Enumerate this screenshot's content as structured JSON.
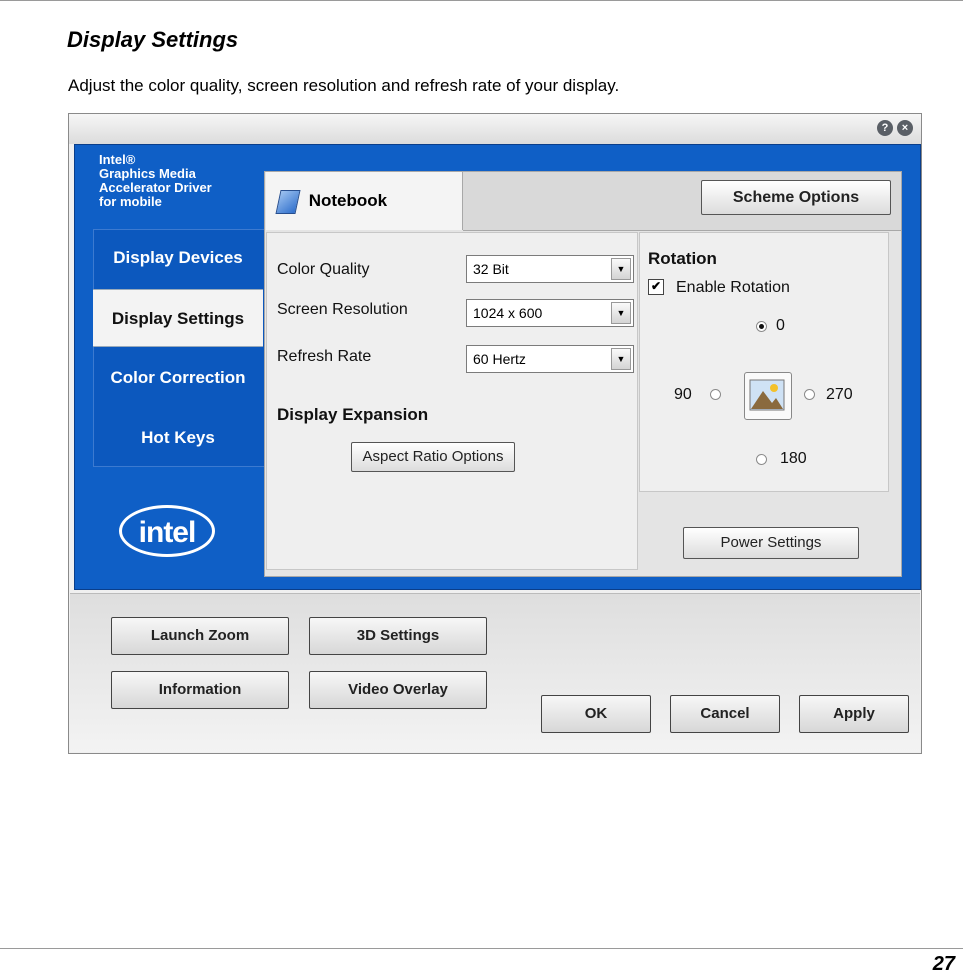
{
  "doc": {
    "title": "Display Settings",
    "description": "Adjust the color quality, screen resolution and refresh rate of your display.",
    "page_number": "27"
  },
  "window": {
    "titlebar_buttons": [
      {
        "icon": "help-icon",
        "glyph": "?"
      },
      {
        "icon": "close-icon",
        "glyph": "×"
      }
    ]
  },
  "sidebar": {
    "brand_lines": [
      "Intel®",
      "Graphics Media",
      "Accelerator Driver",
      "for mobile"
    ],
    "items": [
      {
        "label": "Display Devices",
        "active": false
      },
      {
        "label": "Display Settings",
        "active": true
      },
      {
        "label": "Color Correction",
        "active": false
      },
      {
        "label": "Hot Keys",
        "active": false
      }
    ],
    "logo_text": "intel"
  },
  "tab": {
    "label": "Notebook",
    "icon": "notebook-icon"
  },
  "scheme_options_label": "Scheme Options",
  "settings": {
    "color_quality_label": "Color Quality",
    "color_quality_value": "32 Bit",
    "screen_resolution_label": "Screen Resolution",
    "screen_resolution_value": "1024 x 600",
    "refresh_rate_label": "Refresh Rate",
    "refresh_rate_value": "60 Hertz",
    "display_expansion_heading": "Display Expansion",
    "aspect_ratio_button": "Aspect Ratio Options"
  },
  "rotation": {
    "heading": "Rotation",
    "enable_label": "Enable Rotation",
    "enabled": true,
    "options": {
      "r0": "0",
      "r90": "90",
      "r270": "270",
      "r180": "180"
    },
    "selected": "0",
    "power_settings_button": "Power Settings"
  },
  "footer": {
    "launch_zoom": "Launch Zoom",
    "settings_3d": "3D Settings",
    "information": "Information",
    "video_overlay": "Video Overlay",
    "ok": "OK",
    "cancel": "Cancel",
    "apply": "Apply"
  },
  "colors": {
    "panel_blue": "#0f5fc6",
    "window_bg": "#f0f0f0"
  }
}
